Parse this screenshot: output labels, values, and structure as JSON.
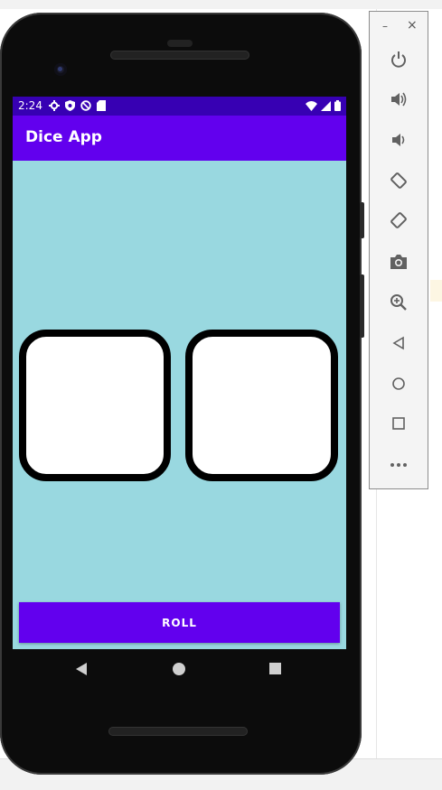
{
  "status_bar": {
    "time": "2:24",
    "background": "#3700b3"
  },
  "app_bar": {
    "title": "Dice App",
    "background": "#6200ee"
  },
  "content": {
    "background": "#99d8e0",
    "dice": [
      {
        "face": "blank"
      },
      {
        "face": "blank"
      }
    ]
  },
  "roll_button": {
    "label": "ROLL",
    "background": "#6200ee"
  },
  "nav_bar": {
    "icons": [
      "back-icon",
      "home-icon",
      "recents-icon"
    ]
  },
  "emulator_toolbar": {
    "window_controls": {
      "minimize": "–",
      "close": "×"
    },
    "icons": [
      "power-icon",
      "volume-up-icon",
      "volume-down-icon",
      "rotate-left-icon",
      "rotate-right-icon",
      "camera-icon",
      "zoom-icon",
      "back-icon",
      "home-icon",
      "overview-icon",
      "more-icon"
    ]
  }
}
